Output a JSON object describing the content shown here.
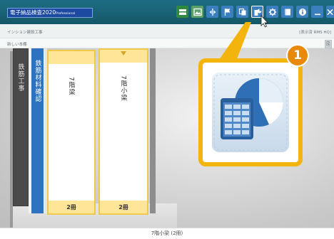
{
  "app": {
    "title": "電子納品検査2020",
    "edition": "Professional"
  },
  "toolbar": {
    "buttons": [
      {
        "name": "toolbar-shelf-icon",
        "color": "#2e8a3e"
      },
      {
        "name": "toolbar-image-icon",
        "color": "#5aa06a"
      },
      {
        "name": "toolbar-split-icon",
        "color": "#3b7fbf"
      },
      {
        "name": "toolbar-flag-icon",
        "color": "#3b7fbf"
      },
      {
        "name": "toolbar-copy-icon",
        "color": "#3b7fbf"
      },
      {
        "name": "toolbar-book-chart-icon",
        "color": "#3b7fbf"
      },
      {
        "name": "toolbar-gear-icon",
        "color": "#3b7fbf"
      },
      {
        "name": "toolbar-book-icon",
        "color": "#3b7fbf"
      },
      {
        "name": "toolbar-info-icon",
        "color": "#3b7fbf"
      },
      {
        "name": "minimize-icon",
        "color": "#3b7fbf"
      },
      {
        "name": "close-icon",
        "color": "#3b7fbf"
      }
    ]
  },
  "status": {
    "project": "インション建設工事",
    "view_mode": "[表示済 RMS HQ]",
    "breadcrumb": "新しい本棚"
  },
  "binders": [
    {
      "label": "鉄筋工事",
      "count": ""
    },
    {
      "label": "鉄筋材料確認",
      "count": ""
    },
    {
      "label": "7階梁",
      "count": "2冊"
    },
    {
      "label": "7階小梁",
      "count": "2冊"
    }
  ],
  "footer": {
    "selection": "7階小梁 (2冊)"
  },
  "callout": {
    "number": "1",
    "accent": "#f4b40e",
    "badge_color": "#e8890c"
  }
}
